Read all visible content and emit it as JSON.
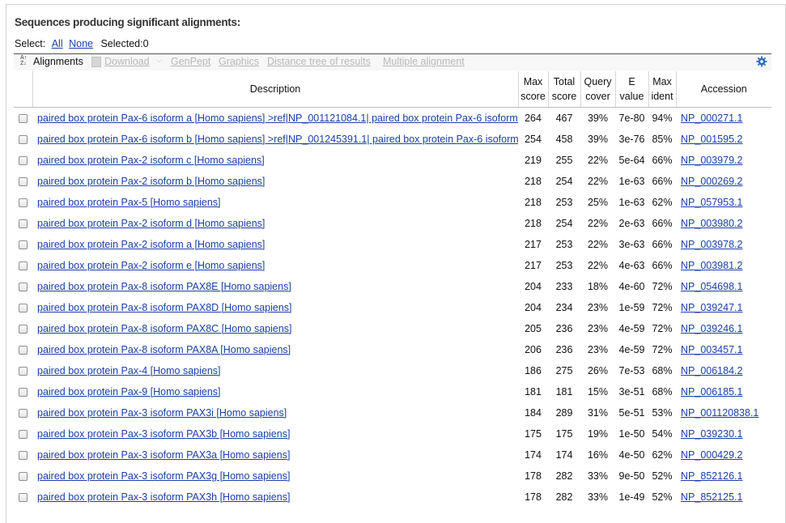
{
  "title": "Sequences producing significant alignments:",
  "select": {
    "label": "Select:",
    "all": "All",
    "none": "None",
    "selected": "Selected:0"
  },
  "toolbar": {
    "alignments": "Alignments",
    "download": "Download",
    "genpept": "GenPept",
    "graphics": "Graphics",
    "distance_tree": "Distance tree of results",
    "multiple_alignment": "Multiple alignment"
  },
  "columns": {
    "description": "Description",
    "max_score": [
      "Max",
      "score"
    ],
    "total_score": [
      "Total",
      "score"
    ],
    "query_cover": [
      "Query",
      "cover"
    ],
    "e_value": [
      "E",
      "value"
    ],
    "max_ident": [
      "Max",
      "ident"
    ],
    "accession": "Accession"
  },
  "rows": [
    {
      "desc": "paired box protein Pax-6 isoform a [Homo sapiens] >ref|NP_001121084.1| paired box protein Pax-6 isoform a",
      "max": "264",
      "total": "467",
      "cover": "39%",
      "e": "7e-80",
      "ident": "94%",
      "acc": "NP_000271.1"
    },
    {
      "desc": "paired box protein Pax-6 isoform b [Homo sapiens] >ref|NP_001245391.1| paired box protein Pax-6 isoform b",
      "max": "254",
      "total": "458",
      "cover": "39%",
      "e": "3e-76",
      "ident": "85%",
      "acc": "NP_001595.2"
    },
    {
      "desc": "paired box protein Pax-2 isoform c [Homo sapiens]",
      "max": "219",
      "total": "255",
      "cover": "22%",
      "e": "5e-64",
      "ident": "66%",
      "acc": "NP_003979.2"
    },
    {
      "desc": "paired box protein Pax-2 isoform b [Homo sapiens]",
      "max": "218",
      "total": "254",
      "cover": "22%",
      "e": "1e-63",
      "ident": "66%",
      "acc": "NP_000269.2"
    },
    {
      "desc": "paired box protein Pax-5 [Homo sapiens]",
      "max": "218",
      "total": "253",
      "cover": "25%",
      "e": "1e-63",
      "ident": "62%",
      "acc": "NP_057953.1"
    },
    {
      "desc": "paired box protein Pax-2 isoform d [Homo sapiens]",
      "max": "218",
      "total": "254",
      "cover": "22%",
      "e": "2e-63",
      "ident": "66%",
      "acc": "NP_003980.2"
    },
    {
      "desc": "paired box protein Pax-2 isoform a [Homo sapiens]",
      "max": "217",
      "total": "253",
      "cover": "22%",
      "e": "3e-63",
      "ident": "66%",
      "acc": "NP_003978.2"
    },
    {
      "desc": "paired box protein Pax-2 isoform e [Homo sapiens]",
      "max": "217",
      "total": "253",
      "cover": "22%",
      "e": "4e-63",
      "ident": "66%",
      "acc": "NP_003981.2"
    },
    {
      "desc": "paired box protein Pax-8 isoform PAX8E [Homo sapiens]",
      "max": "204",
      "total": "233",
      "cover": "18%",
      "e": "4e-60",
      "ident": "72%",
      "acc": "NP_054698.1"
    },
    {
      "desc": "paired box protein Pax-8 isoform PAX8D [Homo sapiens]",
      "max": "204",
      "total": "234",
      "cover": "23%",
      "e": "1e-59",
      "ident": "72%",
      "acc": "NP_039247.1"
    },
    {
      "desc": "paired box protein Pax-8 isoform PAX8C [Homo sapiens]",
      "max": "205",
      "total": "236",
      "cover": "23%",
      "e": "4e-59",
      "ident": "72%",
      "acc": "NP_039246.1"
    },
    {
      "desc": "paired box protein Pax-8 isoform PAX8A [Homo sapiens]",
      "max": "206",
      "total": "236",
      "cover": "23%",
      "e": "4e-59",
      "ident": "72%",
      "acc": "NP_003457.1"
    },
    {
      "desc": "paired box protein Pax-4 [Homo sapiens]",
      "max": "186",
      "total": "275",
      "cover": "26%",
      "e": "7e-53",
      "ident": "68%",
      "acc": "NP_006184.2"
    },
    {
      "desc": "paired box protein Pax-9 [Homo sapiens]",
      "max": "181",
      "total": "181",
      "cover": "15%",
      "e": "3e-51",
      "ident": "68%",
      "acc": "NP_006185.1"
    },
    {
      "desc": "paired box protein Pax-3 isoform PAX3i [Homo sapiens]",
      "max": "184",
      "total": "289",
      "cover": "31%",
      "e": "5e-51",
      "ident": "53%",
      "acc": "NP_001120838.1"
    },
    {
      "desc": "paired box protein Pax-3 isoform PAX3b [Homo sapiens]",
      "max": "175",
      "total": "175",
      "cover": "19%",
      "e": "1e-50",
      "ident": "54%",
      "acc": "NP_039230.1"
    },
    {
      "desc": "paired box protein Pax-3 isoform PAX3a [Homo sapiens]",
      "max": "174",
      "total": "174",
      "cover": "16%",
      "e": "4e-50",
      "ident": "62%",
      "acc": "NP_000429.2"
    },
    {
      "desc": "paired box protein Pax-3 isoform PAX3g [Homo sapiens]",
      "max": "178",
      "total": "282",
      "cover": "33%",
      "e": "9e-50",
      "ident": "52%",
      "acc": "NP_852126.1"
    },
    {
      "desc": "paired box protein Pax-3 isoform PAX3h [Homo sapiens]",
      "max": "178",
      "total": "282",
      "cover": "33%",
      "e": "1e-49",
      "ident": "52%",
      "acc": "NP_852125.1"
    }
  ],
  "colors": {
    "link": "#1a3fa8",
    "gear": "#2a6fc7",
    "disabled": "#b8b8b8"
  }
}
